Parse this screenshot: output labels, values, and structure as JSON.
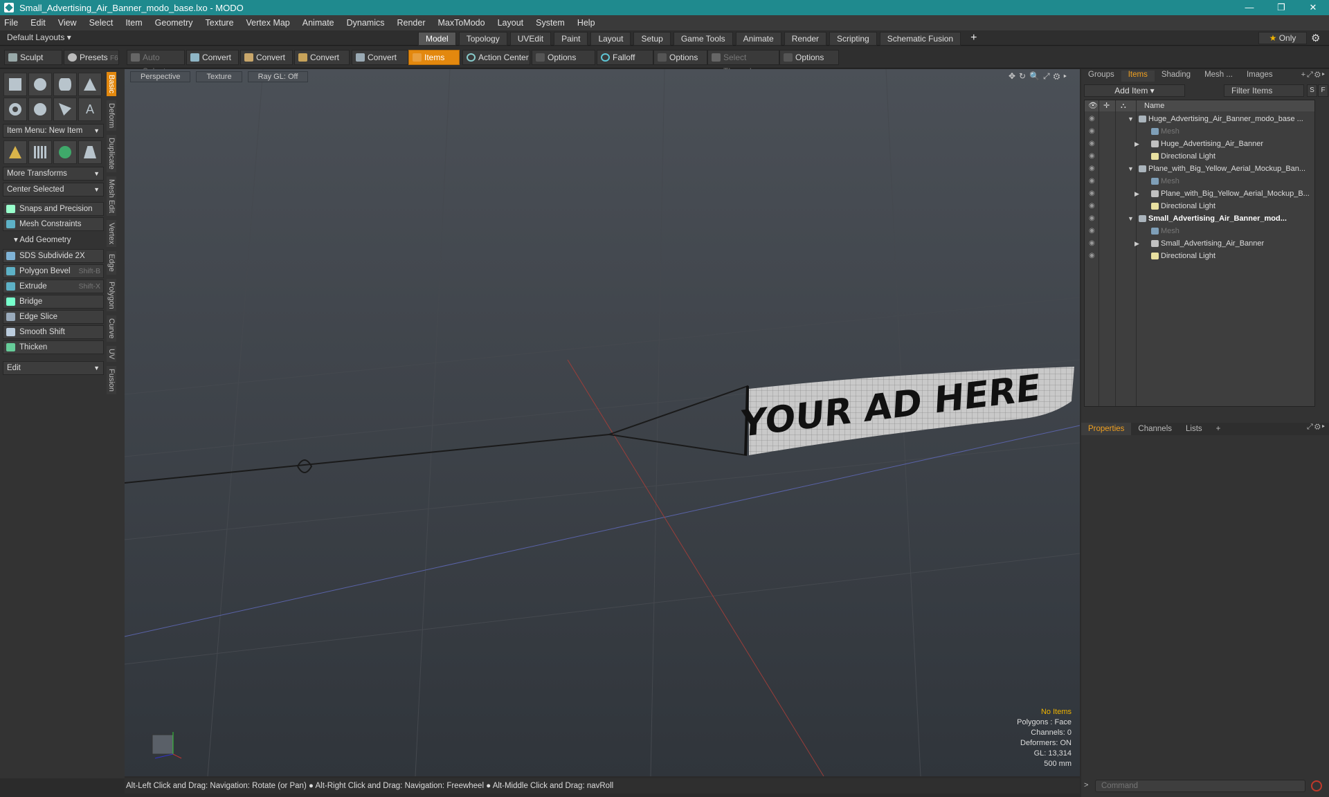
{
  "window": {
    "title": "Small_Advertising_Air_Banner_modo_base.lxo - MODO"
  },
  "menu": [
    "File",
    "Edit",
    "View",
    "Select",
    "Item",
    "Geometry",
    "Texture",
    "Vertex Map",
    "Animate",
    "Dynamics",
    "Render",
    "MaxToModo",
    "Layout",
    "System",
    "Help"
  ],
  "layout": {
    "default_label": "Default Layouts ▾",
    "tabs": [
      "Model",
      "Topology",
      "UVEdit",
      "Paint",
      "Layout",
      "Setup",
      "Game Tools",
      "Animate",
      "Render",
      "Scripting",
      "Schematic Fusion"
    ],
    "active_tab": "Model",
    "only_label": "Only"
  },
  "toolbar": {
    "sculpt": "Sculpt",
    "presets": "Presets",
    "presets_key": "F6",
    "auto_select": "Auto Select",
    "convert1": "Convert",
    "convert2": "Convert",
    "convert3": "Convert",
    "convert4": "Convert",
    "items": "Items",
    "action_center": "Action Center",
    "options1": "Options",
    "falloff": "Falloff",
    "options2": "Options",
    "select_through": "Select Through",
    "options3": "Options"
  },
  "left": {
    "item_menu": "Item Menu: New Item",
    "more_transforms": "More Transforms",
    "center_selected": "Center Selected",
    "snaps": "Snaps and Precision",
    "mesh_constraints": "Mesh Constraints",
    "add_geometry": "Add Geometry",
    "tools": [
      {
        "label": "SDS Subdivide 2X",
        "shortcut": ""
      },
      {
        "label": "Polygon Bevel",
        "shortcut": "Shift-B"
      },
      {
        "label": "Extrude",
        "shortcut": "Shift-X"
      },
      {
        "label": "Bridge",
        "shortcut": ""
      },
      {
        "label": "Edge Slice",
        "shortcut": ""
      },
      {
        "label": "Smooth Shift",
        "shortcut": ""
      },
      {
        "label": "Thicken",
        "shortcut": ""
      }
    ],
    "edit": "Edit",
    "vtabs": [
      "Basic",
      "Deform",
      "Duplicate",
      "Mesh Edit",
      "Vertex",
      "Edge",
      "Polygon",
      "Curve",
      "UV",
      "Fusion"
    ]
  },
  "viewport": {
    "perspective": "Perspective",
    "texture": "Texture",
    "raygl": "Ray GL: Off",
    "banner_text": "YOUR AD HERE",
    "stats": {
      "no_items": "No Items",
      "polygons": "Polygons : Face",
      "channels": "Channels: 0",
      "deformers": "Deformers: ON",
      "gl": "GL: 13,314",
      "scale": "500 mm"
    }
  },
  "status": "Alt-Left Click and Drag: Navigation: Rotate (or Pan) ● Alt-Right Click and Drag: Navigation: Freewheel ● Alt-Middle Click and Drag: navRoll",
  "right": {
    "tabs": [
      "Groups",
      "Items",
      "Shading",
      "Mesh ...",
      "Images"
    ],
    "active_tab": "Items",
    "add_item": "Add Item",
    "filter": "Filter Items",
    "s": "S",
    "f": "F",
    "name_col": "Name",
    "tree": [
      {
        "label": "Huge_Advertising_Air_Banner_modo_base ...",
        "type": "scene",
        "arrow": "▼",
        "depth": 0,
        "dim": false,
        "bold": false
      },
      {
        "label": "Mesh",
        "type": "mesh",
        "arrow": "",
        "depth": 1,
        "dim": true,
        "bold": false
      },
      {
        "label": "Huge_Advertising_Air_Banner",
        "type": "group",
        "arrow": "▶",
        "depth": 1,
        "dim": false,
        "bold": false
      },
      {
        "label": "Directional Light",
        "type": "light",
        "arrow": "",
        "depth": 1,
        "dim": false,
        "bold": false
      },
      {
        "label": "Plane_with_Big_Yellow_Aerial_Mockup_Ban...",
        "type": "scene",
        "arrow": "▼",
        "depth": 0,
        "dim": false,
        "bold": false
      },
      {
        "label": "Mesh",
        "type": "mesh",
        "arrow": "",
        "depth": 1,
        "dim": true,
        "bold": false
      },
      {
        "label": "Plane_with_Big_Yellow_Aerial_Mockup_B...",
        "type": "group",
        "arrow": "▶",
        "depth": 1,
        "dim": false,
        "bold": false
      },
      {
        "label": "Directional Light",
        "type": "light",
        "arrow": "",
        "depth": 1,
        "dim": false,
        "bold": false
      },
      {
        "label": "Small_Advertising_Air_Banner_mod...",
        "type": "scene",
        "arrow": "▼",
        "depth": 0,
        "dim": false,
        "bold": true
      },
      {
        "label": "Mesh",
        "type": "mesh",
        "arrow": "",
        "depth": 1,
        "dim": true,
        "bold": false
      },
      {
        "label": "Small_Advertising_Air_Banner",
        "type": "group",
        "arrow": "▶",
        "depth": 1,
        "dim": false,
        "bold": false
      },
      {
        "label": "Directional Light",
        "type": "light",
        "arrow": "",
        "depth": 1,
        "dim": false,
        "bold": false
      }
    ],
    "tabs2": [
      "Properties",
      "Channels",
      "Lists"
    ],
    "active_tab2": "Properties",
    "command_placeholder": "Command"
  }
}
